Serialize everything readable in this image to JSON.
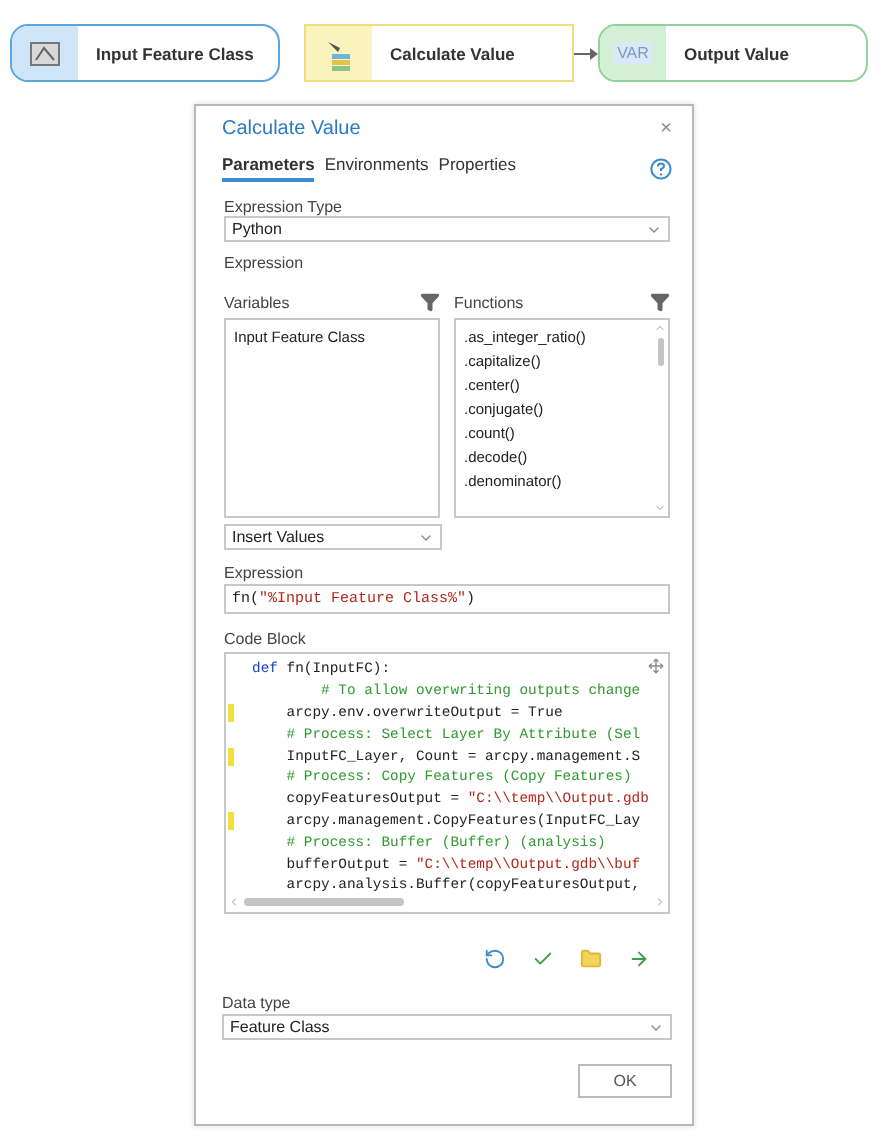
{
  "model": {
    "nodes": [
      {
        "label": "Input Feature Class",
        "kind": "data"
      },
      {
        "label": "Calculate Value",
        "kind": "tool"
      },
      {
        "label": "Output Value",
        "kind": "variable",
        "badge": "VAR"
      }
    ]
  },
  "dialog": {
    "title": "Calculate Value",
    "close": "×",
    "tabs": [
      {
        "label": "Parameters",
        "selected": true
      },
      {
        "label": "Environments",
        "selected": false
      },
      {
        "label": "Properties",
        "selected": false
      }
    ],
    "expression_type": {
      "label": "Expression Type",
      "value": "Python"
    },
    "expression_section": "Expression",
    "variables": {
      "label": "Variables",
      "items": [
        "Input Feature Class"
      ]
    },
    "functions": {
      "label": "Functions",
      "items": [
        ".as_integer_ratio()",
        ".capitalize()",
        ".center()",
        ".conjugate()",
        ".count()",
        ".decode()",
        ".denominator()"
      ]
    },
    "insert_values": "Insert Values",
    "expression": {
      "label": "Expression",
      "tokens": [
        {
          "kind": "plain",
          "text": "fn("
        },
        {
          "kind": "string",
          "text": "\"%Input Feature Class%\""
        },
        {
          "kind": "plain",
          "text": ")"
        }
      ]
    },
    "code_block": {
      "label": "Code Block",
      "lines": [
        {
          "changed": false,
          "tokens": [
            {
              "kind": "keyword",
              "text": "def"
            },
            {
              "kind": "plain",
              "text": " fn(InputFC):"
            }
          ]
        },
        {
          "changed": false,
          "tokens": [
            {
              "kind": "comment",
              "text": "        # To allow overwriting outputs change"
            }
          ]
        },
        {
          "changed": true,
          "tokens": [
            {
              "kind": "plain",
              "text": "    arcpy.env.overwriteOutput = True"
            }
          ]
        },
        {
          "changed": false,
          "tokens": [
            {
              "kind": "comment",
              "text": "    # Process: Select Layer By Attribute (Sel"
            }
          ]
        },
        {
          "changed": true,
          "tokens": [
            {
              "kind": "plain",
              "text": "    InputFC_Layer, Count = arcpy.management.S"
            }
          ]
        },
        {
          "changed": false,
          "tokens": [
            {
              "kind": "comment",
              "text": "    # Process: Copy Features (Copy Features)"
            }
          ]
        },
        {
          "changed": false,
          "tokens": [
            {
              "kind": "plain",
              "text": "    copyFeaturesOutput = "
            },
            {
              "kind": "string",
              "text": "\"C:\\\\temp\\\\Output.gdb"
            }
          ]
        },
        {
          "changed": true,
          "tokens": [
            {
              "kind": "plain",
              "text": "    arcpy.management.CopyFeatures(InputFC_Lay"
            }
          ]
        },
        {
          "changed": false,
          "tokens": [
            {
              "kind": "comment",
              "text": "    # Process: Buffer (Buffer) (analysis)"
            }
          ]
        },
        {
          "changed": false,
          "tokens": [
            {
              "kind": "plain",
              "text": "    bufferOutput = "
            },
            {
              "kind": "string",
              "text": "\"C:\\\\temp\\\\Output.gdb\\\\buf"
            }
          ]
        },
        {
          "changed": false,
          "tokens": [
            {
              "kind": "plain",
              "text": "    arcpy.analysis.Buffer(copyFeaturesOutput,"
            }
          ]
        }
      ]
    },
    "data_type": {
      "label": "Data type",
      "value": "Feature Class"
    },
    "ok": "OK"
  }
}
